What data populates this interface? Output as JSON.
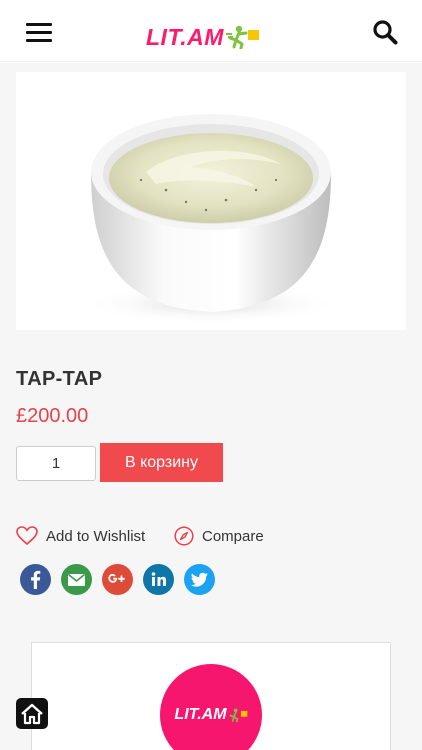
{
  "header": {
    "menu_icon": "hamburger-menu-icon",
    "logo_text": "LIT.AM",
    "search_icon": "search-icon"
  },
  "product": {
    "image_alt": "bowl of sauce",
    "title": "ТАР-ТАР",
    "price": "£200.00",
    "quantity": "1",
    "add_to_cart_label": "В корзину"
  },
  "actions": {
    "wishlist_label": "Add to Wishlist",
    "compare_label": "Compare"
  },
  "share": [
    {
      "name": "facebook-icon",
      "color": "#3b5998"
    },
    {
      "name": "email-icon",
      "color": "#3a9a4a"
    },
    {
      "name": "google-plus-icon",
      "color": "#dd4b39"
    },
    {
      "name": "linkedin-icon",
      "color": "#0e76a8"
    },
    {
      "name": "twitter-icon",
      "color": "#1da1f2"
    }
  ],
  "brand": {
    "logo_text": "LIT.AM"
  },
  "colors": {
    "accent": "#f0494e",
    "price": "#e8424b",
    "brand_pink": "#ff1a6e"
  }
}
